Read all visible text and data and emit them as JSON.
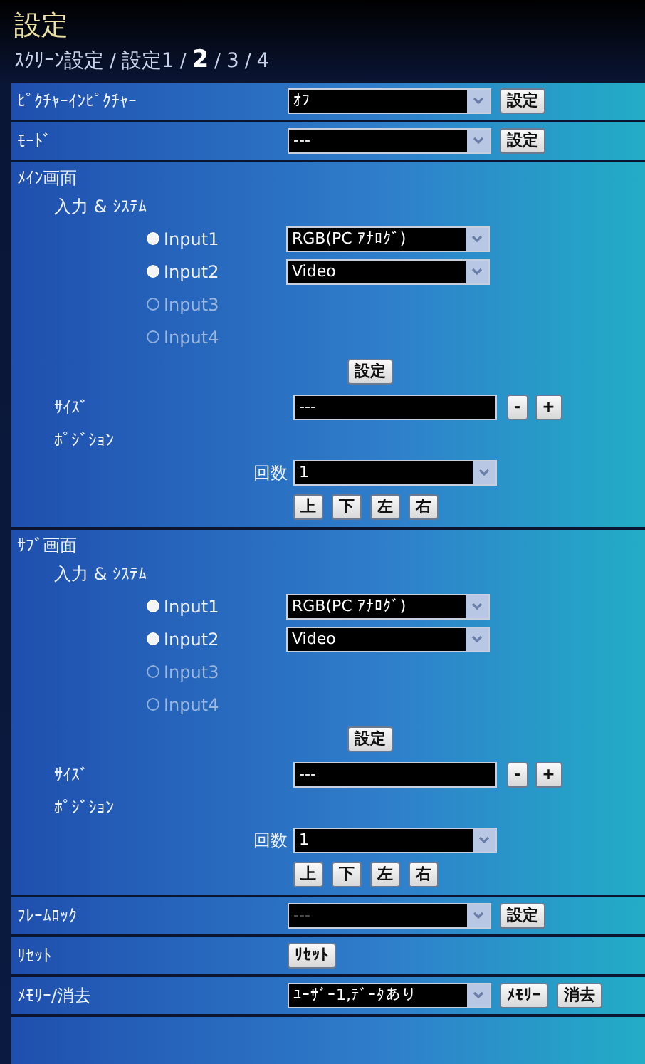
{
  "title": "設定",
  "breadcrumb": [
    {
      "label": "ｽｸﾘｰﾝ設定",
      "selected": false
    },
    {
      "sep": "/",
      "label": "設定1",
      "selected": false
    },
    {
      "sep": "/",
      "label": "2",
      "selected": true
    },
    {
      "sep": "/",
      "label": "3",
      "selected": false
    },
    {
      "sep": "/",
      "label": "4",
      "selected": false
    }
  ],
  "picture_in_picture": {
    "label": "ﾋﾟｸﾁｬｰｲﾝﾋﾟｸﾁｬｰ",
    "value": "ｵﾌ",
    "button": "設定"
  },
  "mode": {
    "label": "ﾓｰﾄﾞ",
    "value": "---",
    "button": "設定"
  },
  "screens": [
    {
      "title": "ﾒｲﾝ画面",
      "input_label": "入力 & ｼｽﾃﾑ",
      "inputs": [
        {
          "label": "Input1",
          "checked": true,
          "disabled": false,
          "value": "RGB(PC ｱﾅﾛｸﾞ)"
        },
        {
          "label": "Input2",
          "checked": true,
          "disabled": false,
          "value": "Video"
        },
        {
          "label": "Input3",
          "checked": false,
          "disabled": true
        },
        {
          "label": "Input4",
          "checked": false,
          "disabled": true
        }
      ],
      "apply_button": "設定",
      "size_label": "ｻｲｽﾞ",
      "size_value": "---",
      "size_buttons": [
        "-",
        "+"
      ],
      "position_label": "ﾎﾟｼﾞｼｮﾝ",
      "count_label": "回数",
      "count_value": "1",
      "direction_buttons": [
        "上",
        "下",
        "左",
        "右"
      ]
    },
    {
      "title": "ｻﾌﾞ画面",
      "input_label": "入力 & ｼｽﾃﾑ",
      "inputs": [
        {
          "label": "Input1",
          "checked": true,
          "disabled": false,
          "value": "RGB(PC ｱﾅﾛｸﾞ)"
        },
        {
          "label": "Input2",
          "checked": true,
          "disabled": false,
          "value": "Video"
        },
        {
          "label": "Input3",
          "checked": false,
          "disabled": true
        },
        {
          "label": "Input4",
          "checked": false,
          "disabled": true
        }
      ],
      "apply_button": "設定",
      "size_label": "ｻｲｽﾞ",
      "size_value": "---",
      "size_buttons": [
        "-",
        "+"
      ],
      "position_label": "ﾎﾟｼﾞｼｮﾝ",
      "count_label": "回数",
      "count_value": "1",
      "direction_buttons": [
        "上",
        "下",
        "左",
        "右"
      ]
    }
  ],
  "frame_lock": {
    "label": "ﾌﾚｰﾑﾛｯｸ",
    "value": "---",
    "disabled": true,
    "button": "設定"
  },
  "reset": {
    "label": "ﾘｾｯﾄ",
    "button": "ﾘｾｯﾄ"
  },
  "memory": {
    "label": "ﾒﾓﾘｰ/消去",
    "value": "ﾕｰｻﾞｰ1,ﾃﾞｰﾀあり",
    "buttons": [
      "ﾒﾓﾘｰ",
      "消去"
    ]
  }
}
